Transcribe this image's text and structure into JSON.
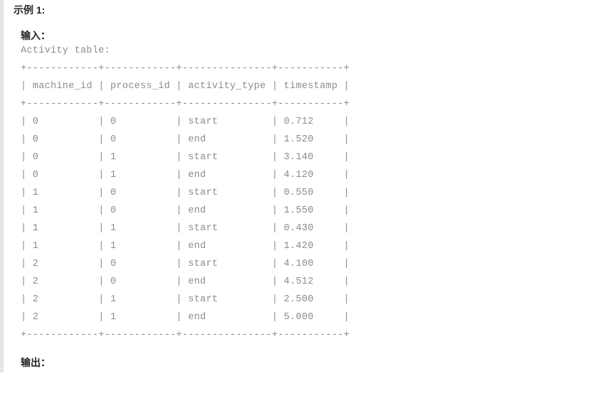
{
  "example_title": "示例 1:",
  "input_label": "输入：",
  "output_label": "输出：",
  "table_name": "Activity table:",
  "table_text": "+------------+------------+---------------+-----------+\n| machine_id | process_id | activity_type | timestamp |\n+------------+------------+---------------+-----------+\n| 0          | 0          | start         | 0.712     |\n| 0          | 0          | end           | 1.520     |\n| 0          | 1          | start         | 3.140     |\n| 0          | 1          | end           | 4.120     |\n| 1          | 0          | start         | 0.550     |\n| 1          | 0          | end           | 1.550     |\n| 1          | 1          | start         | 0.430     |\n| 1          | 1          | end           | 1.420     |\n| 2          | 0          | start         | 4.100     |\n| 2          | 0          | end           | 4.512     |\n| 2          | 1          | start         | 2.500     |\n| 2          | 1          | end           | 5.000     |\n+------------+------------+---------------+-----------+",
  "chart_data": {
    "type": "table",
    "title": "Activity table",
    "columns": [
      "machine_id",
      "process_id",
      "activity_type",
      "timestamp"
    ],
    "rows": [
      [
        0,
        0,
        "start",
        0.712
      ],
      [
        0,
        0,
        "end",
        1.52
      ],
      [
        0,
        1,
        "start",
        3.14
      ],
      [
        0,
        1,
        "end",
        4.12
      ],
      [
        1,
        0,
        "start",
        0.55
      ],
      [
        1,
        0,
        "end",
        1.55
      ],
      [
        1,
        1,
        "start",
        0.43
      ],
      [
        1,
        1,
        "end",
        1.42
      ],
      [
        2,
        0,
        "start",
        4.1
      ],
      [
        2,
        0,
        "end",
        4.512
      ],
      [
        2,
        1,
        "start",
        2.5
      ],
      [
        2,
        1,
        "end",
        5.0
      ]
    ]
  }
}
